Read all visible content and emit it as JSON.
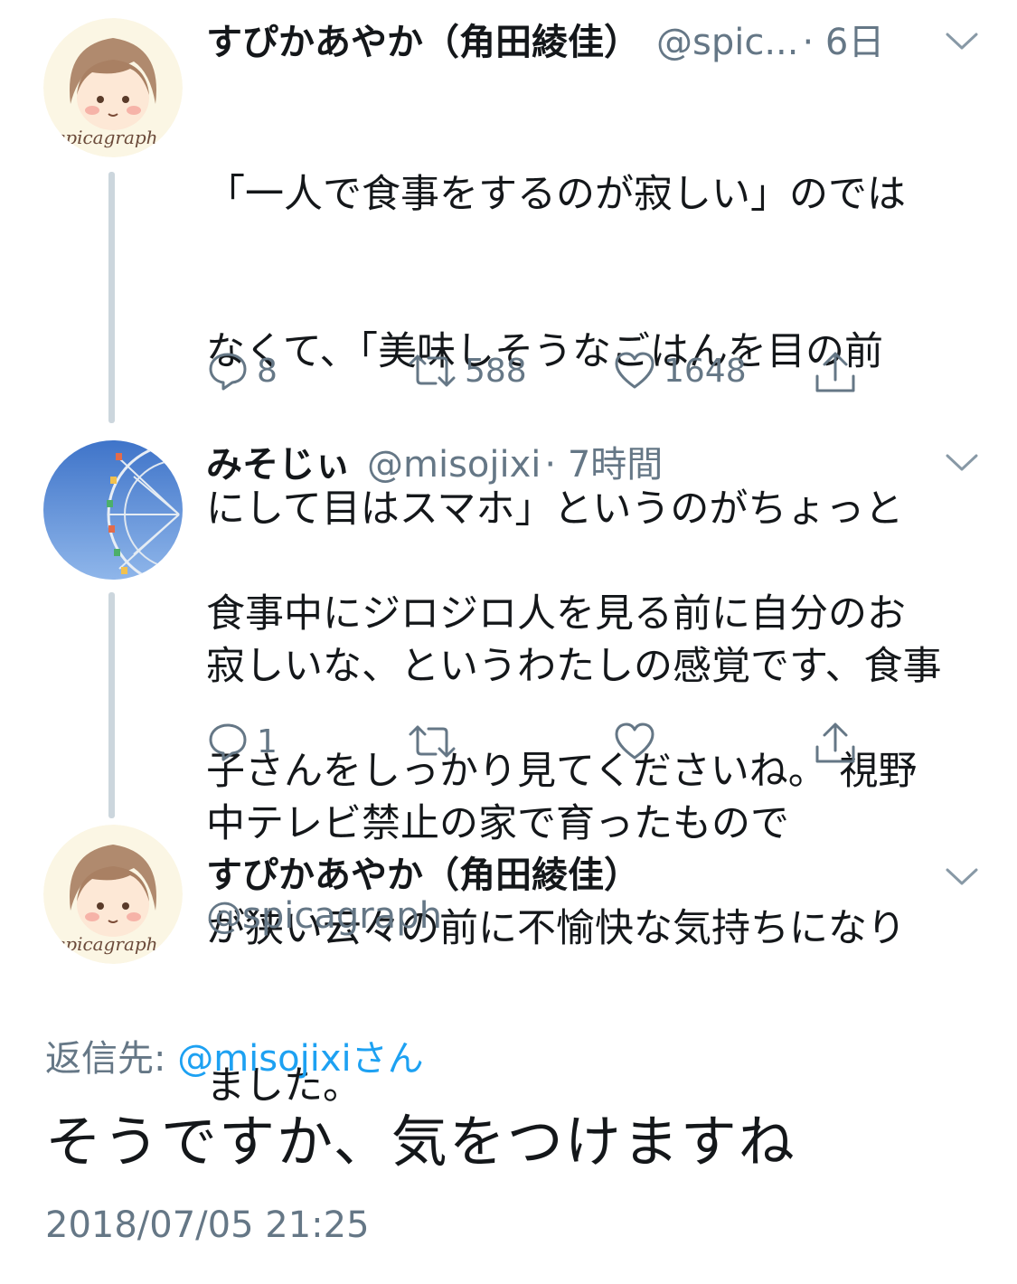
{
  "tweet1": {
    "name": "すぴかあやか（角田綾佳）",
    "handle": "@spic...",
    "time": "· 6日",
    "avatar_text": "spicagraph",
    "text": "「一人で食事をするのが寂しい」のではなくて、「美味しそうなごはんを目の前にして目はスマホ」というのがちょっと寂しいな、というわたしの感覚です、食事中テレビ禁止の家で育ったもので",
    "lines": [
      "「一人で食事をするのが寂しい」のでは",
      "なくて、「美味しそうなごはんを目の前",
      "にして目はスマホ」というのがちょっと",
      "寂しいな、というわたしの感覚です、食事",
      "中テレビ禁止の家で育ったもので"
    ],
    "replies": "8",
    "retweets": "588",
    "likes": "1648"
  },
  "tweet2": {
    "name": "みそじぃ",
    "handle": "@misojixi",
    "time": "· 7時間",
    "lines": [
      "食事中にジロジロ人を見る前に自分のお",
      "子さんをしっかり見てくださいね。 視野",
      "が狭い云々の前に不愉快な気持ちになり",
      "ました。"
    ],
    "replies": "1",
    "retweets": "",
    "likes": ""
  },
  "main_tweet": {
    "name": "すぴかあやか（角田綾佳）",
    "handle": "@spicagraph",
    "avatar_text": "spicagraph",
    "reply_prefix": "返信先: ",
    "reply_mention": "@misojixiさん",
    "text": "そうですか、気をつけますね",
    "timestamp": "2018/07/05 21:25"
  },
  "icons": [
    "reply-icon",
    "retweet-icon",
    "like-icon",
    "share-icon",
    "chevron-down-icon"
  ],
  "colors": {
    "link": "#1da1f2",
    "muted": "#657786",
    "text": "#14171a",
    "thread_line": "#ccd6dd"
  }
}
